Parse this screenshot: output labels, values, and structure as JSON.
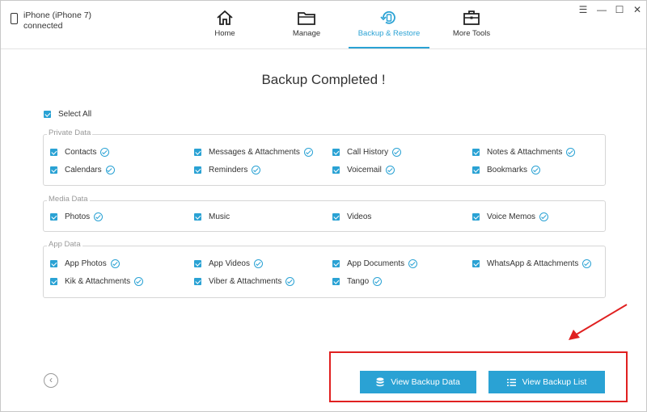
{
  "device": {
    "name": "iPhone (iPhone 7)",
    "status": "connected"
  },
  "nav": {
    "tabs": [
      {
        "label": "Home"
      },
      {
        "label": "Manage"
      },
      {
        "label": "Backup & Restore"
      },
      {
        "label": "More Tools"
      }
    ],
    "active_tab": "Backup & Restore"
  },
  "window_controls": {
    "menu": "☰",
    "minimize": "—",
    "maximize": "☐",
    "close": "✕"
  },
  "page_title": "Backup Completed !",
  "select_all_label": "Select All",
  "groups": [
    {
      "title": "Private Data",
      "items": [
        {
          "label": "Contacts"
        },
        {
          "label": "Messages & Attachments"
        },
        {
          "label": "Call History"
        },
        {
          "label": "Notes & Attachments"
        },
        {
          "label": "Calendars"
        },
        {
          "label": "Reminders"
        },
        {
          "label": "Voicemail"
        },
        {
          "label": "Bookmarks"
        }
      ]
    },
    {
      "title": "Media Data",
      "items": [
        {
          "label": "Photos"
        },
        {
          "label": "Music"
        },
        {
          "label": "Videos"
        },
        {
          "label": "Voice Memos"
        }
      ]
    },
    {
      "title": "App Data",
      "items": [
        {
          "label": "App Photos"
        },
        {
          "label": "App Videos"
        },
        {
          "label": "App Documents"
        },
        {
          "label": "WhatsApp & Attachments"
        },
        {
          "label": "Kik & Attachments"
        },
        {
          "label": "Viber & Attachments"
        },
        {
          "label": "Tango"
        }
      ]
    }
  ],
  "buttons": {
    "view_backup_data": "View Backup Data",
    "view_backup_list": "View Backup List"
  },
  "colors": {
    "accent": "#2aa2d4",
    "highlight": "#e02020"
  }
}
